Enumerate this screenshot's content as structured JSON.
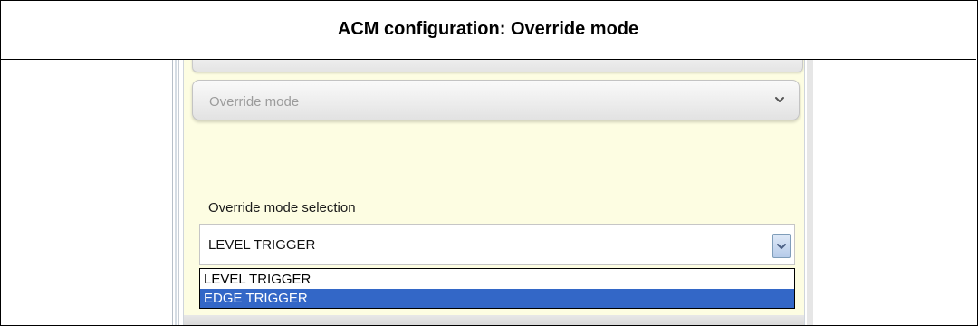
{
  "caption": {
    "title": "ACM configuration: Override mode"
  },
  "panel": {
    "section_header": "Override mode",
    "field_label": "Override mode selection",
    "select": {
      "value": "LEVEL TRIGGER",
      "options": [
        "LEVEL TRIGGER",
        "EDGE TRIGGER"
      ],
      "highlighted_option": "EDGE TRIGGER"
    }
  },
  "icons": {
    "section_chevron": "chevron-down-icon",
    "select_arrow": "chevron-down-icon"
  },
  "colors": {
    "panel_background": "#fdfde2",
    "highlight": "#3367c7"
  }
}
